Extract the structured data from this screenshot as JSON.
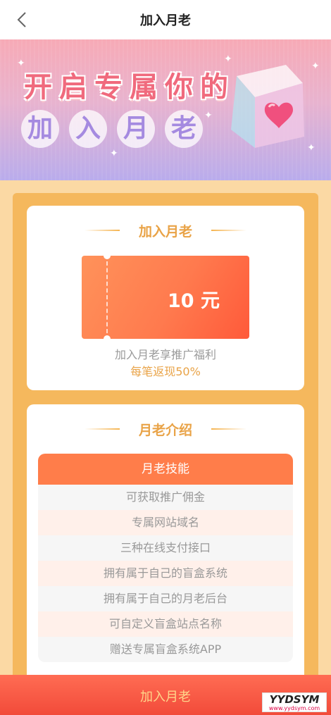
{
  "nav": {
    "title": "加入月老"
  },
  "banner": {
    "line1": [
      "开",
      "启",
      "专",
      "属",
      "你",
      "的"
    ],
    "line2": [
      "加",
      "入",
      "月",
      "老"
    ]
  },
  "join_card": {
    "title": "加入月老",
    "coupon_amount": "10 元",
    "desc": "加入月老享推广福利",
    "highlight": "每笔返现50%"
  },
  "intro_card": {
    "title": "月老介绍",
    "table_header": "月老技能",
    "skills": [
      "可获取推广佣金",
      "专属网站域名",
      "三种在线支付接口",
      "拥有属于自己的盲盒系统",
      "拥有属于自己的月老后台",
      "可自定义盲盒站点名称",
      "赠送专属盲盒系统APP"
    ]
  },
  "bottom_button": {
    "label": "加入月老"
  },
  "watermark": {
    "line1": "YYDSYM",
    "line2": "www.yydsym.com"
  }
}
